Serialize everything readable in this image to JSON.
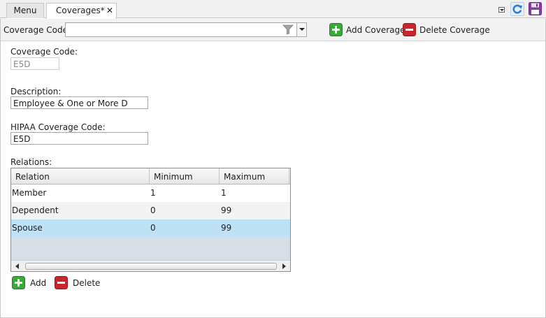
{
  "tabs": {
    "menu": "Menu",
    "coverages": "Coverages*",
    "close_glyph": "✕"
  },
  "toolbar": {
    "coverage_code_label": "Coverage Code:",
    "coverage_code_value": "",
    "add_label": "Add Coverage",
    "delete_label": "Delete Coverage"
  },
  "form": {
    "coverage_code_label": "Coverage Code:",
    "coverage_code_value": "E5D",
    "description_label": "Description:",
    "description_value": "Employee & One or More D",
    "hipaa_label": "HIPAA Coverage Code:",
    "hipaa_value": "E5D",
    "relations_label": "Relations:"
  },
  "relations": {
    "columns": [
      "Relation",
      "Minimum",
      "Maximum"
    ],
    "rows": [
      [
        "Member",
        "1",
        "1"
      ],
      [
        "Dependent",
        "0",
        "99"
      ],
      [
        "Spouse",
        "0",
        "99"
      ]
    ],
    "selected_row": 2
  },
  "buttons": {
    "add": "Add",
    "delete": "Delete"
  },
  "colors": {
    "add_green": "#3aa83a",
    "delete_red": "#c8262c",
    "selected_row": "#bfe1f6",
    "refresh_blue": "#2c7fd6",
    "save_purple": "#8a3aa8"
  },
  "icons": {
    "add": "plus-icon",
    "delete": "minus-icon",
    "refresh": "refresh-icon",
    "save": "save-icon",
    "filter": "funnel-icon"
  }
}
